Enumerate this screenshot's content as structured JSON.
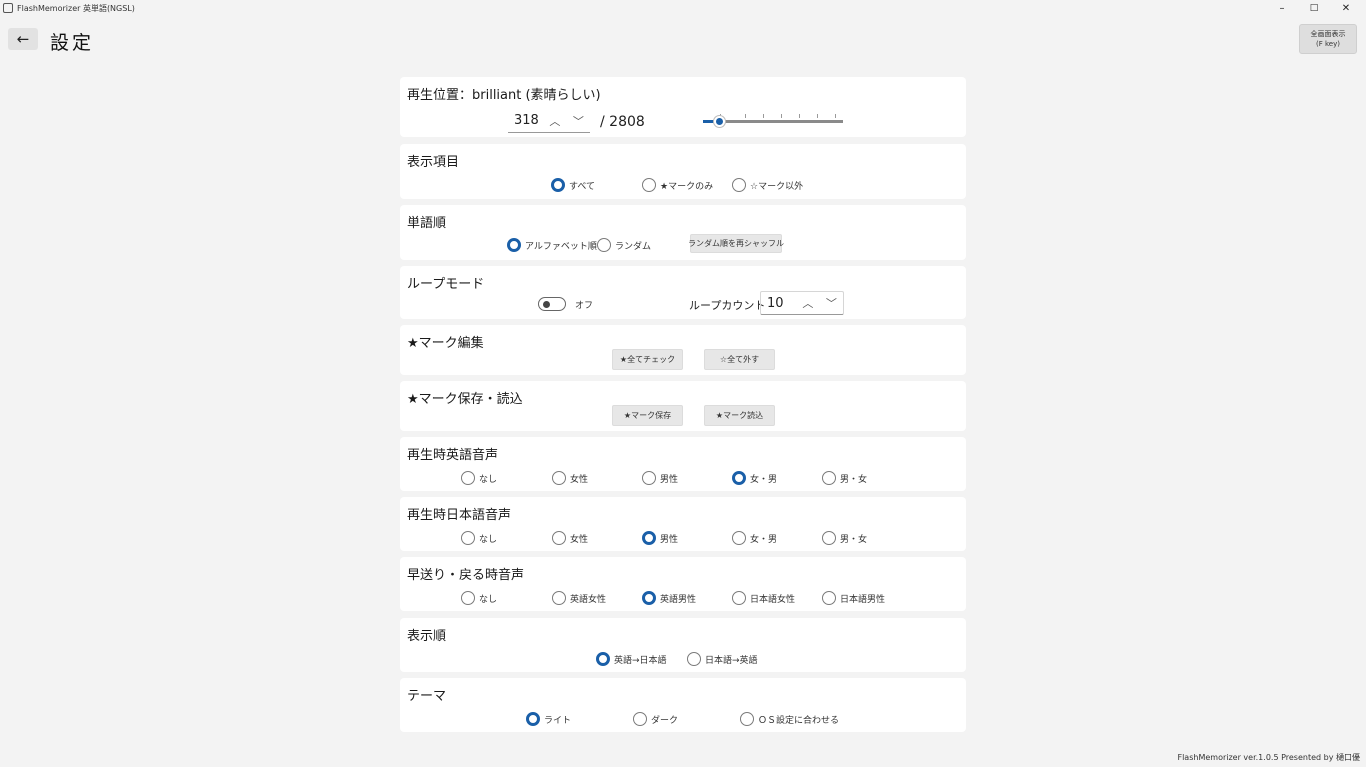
{
  "window": {
    "title": "FlashMemorizer 英単語(NGSL)",
    "minimize": "–",
    "maximize": "□",
    "close": "✕"
  },
  "header": {
    "back_glyph": "←",
    "title": "設定",
    "fullscreen_line1": "全画面表示",
    "fullscreen_line2": "(F key)"
  },
  "playback": {
    "title": "再生位置：brilliant (素晴らしい)",
    "current": "318",
    "total": "/ 2808",
    "up": "︿",
    "down": "﹀",
    "progress_fraction": 0.113
  },
  "display_items": {
    "title": "表示項目",
    "options": [
      "すべて",
      "★マークのみ",
      "☆マーク以外"
    ],
    "selected": 0
  },
  "word_order": {
    "title": "単語順",
    "options": [
      "アルファベット順",
      "ランダム"
    ],
    "selected": 0,
    "reshuffle": "ランダム順を再シャッフル"
  },
  "loop_mode": {
    "title": "ループモード",
    "toggle_label": "オフ",
    "count_label": "ループカウント",
    "count": "10",
    "up": "︿",
    "down": "﹀"
  },
  "mark_edit": {
    "title": "★マーク編集",
    "check_all": "★全てチェック",
    "uncheck_all": "☆全て外す"
  },
  "mark_save": {
    "title": "★マーク保存・読込",
    "save": "★マーク保存",
    "load": "★マーク読込"
  },
  "en_voice": {
    "title": "再生時英語音声",
    "options": [
      "なし",
      "女性",
      "男性",
      "女・男",
      "男・女"
    ],
    "selected": 3
  },
  "ja_voice": {
    "title": "再生時日本語音声",
    "options": [
      "なし",
      "女性",
      "男性",
      "女・男",
      "男・女"
    ],
    "selected": 2
  },
  "skip_voice": {
    "title": "早送り・戻る時音声",
    "options": [
      "なし",
      "英語女性",
      "英語男性",
      "日本語女性",
      "日本語男性"
    ],
    "selected": 2
  },
  "display_order": {
    "title": "表示順",
    "options": [
      "英語→日本語",
      "日本語→英語"
    ],
    "selected": 0
  },
  "theme": {
    "title": "テーマ",
    "options": [
      "ライト",
      "ダーク",
      "ＯＳ設定に合わせる"
    ],
    "selected": 0
  },
  "footer": "FlashMemorizer ver.1.0.5  Presented by 樋口優"
}
